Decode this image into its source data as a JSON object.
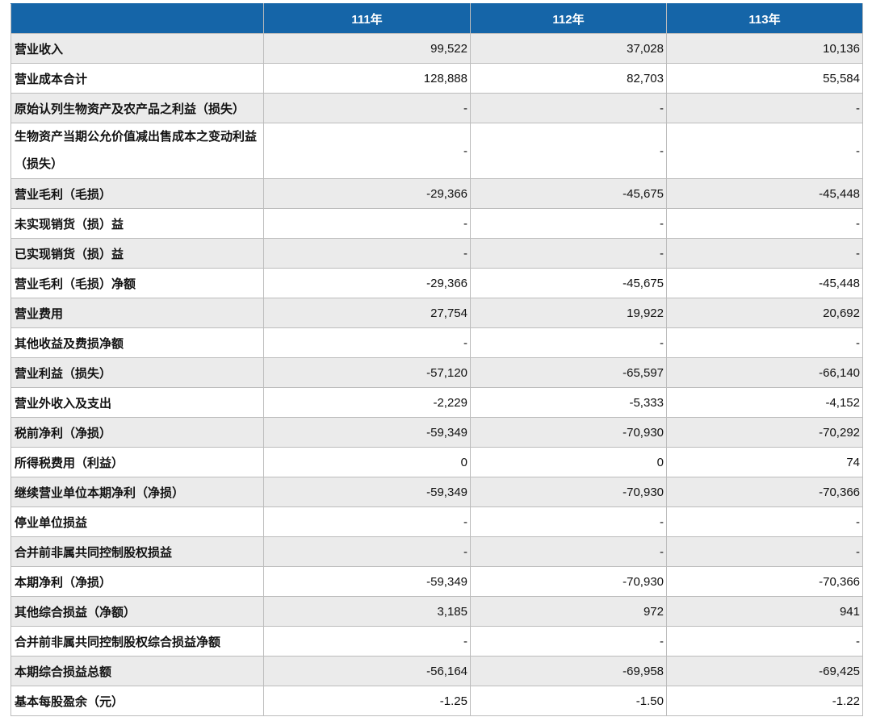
{
  "table": {
    "headers": [
      "",
      "111年",
      "112年",
      "113年"
    ],
    "rows": [
      {
        "label": "营业收入",
        "values": [
          "99,522",
          "37,028",
          "10,136"
        ]
      },
      {
        "label": "营业成本合计",
        "values": [
          "128,888",
          "82,703",
          "55,584"
        ]
      },
      {
        "label": "原始认列生物资产及农产品之利益（损失）",
        "values": [
          "-",
          "-",
          "-"
        ]
      },
      {
        "label": "生物资产当期公允价值减出售成本之变动利益（损失）",
        "values": [
          "-",
          "-",
          "-"
        ]
      },
      {
        "label": "营业毛利（毛损）",
        "values": [
          "-29,366",
          "-45,675",
          "-45,448"
        ]
      },
      {
        "label": "未实现销货（损）益",
        "values": [
          "-",
          "-",
          "-"
        ]
      },
      {
        "label": "已实现销货（损）益",
        "values": [
          "-",
          "-",
          "-"
        ]
      },
      {
        "label": "营业毛利（毛损）净额",
        "values": [
          "-29,366",
          "-45,675",
          "-45,448"
        ]
      },
      {
        "label": "营业费用",
        "values": [
          "27,754",
          "19,922",
          "20,692"
        ]
      },
      {
        "label": "其他收益及费损净额",
        "values": [
          "-",
          "-",
          "-"
        ]
      },
      {
        "label": "营业利益（损失）",
        "values": [
          "-57,120",
          "-65,597",
          "-66,140"
        ]
      },
      {
        "label": "营业外收入及支出",
        "values": [
          "-2,229",
          "-5,333",
          "-4,152"
        ]
      },
      {
        "label": "税前净利（净损）",
        "values": [
          "-59,349",
          "-70,930",
          "-70,292"
        ]
      },
      {
        "label": "所得税费用（利益）",
        "values": [
          "0",
          "0",
          "74"
        ]
      },
      {
        "label": "继续营业单位本期净利（净损）",
        "values": [
          "-59,349",
          "-70,930",
          "-70,366"
        ]
      },
      {
        "label": "停业单位损益",
        "values": [
          "-",
          "-",
          "-"
        ]
      },
      {
        "label": "合并前非属共同控制股权损益",
        "values": [
          "-",
          "-",
          "-"
        ]
      },
      {
        "label": "本期净利（净损）",
        "values": [
          "-59,349",
          "-70,930",
          "-70,366"
        ]
      },
      {
        "label": "其他综合损益（净额）",
        "values": [
          "3,185",
          "972",
          "941"
        ]
      },
      {
        "label": "合并前非属共同控制股权综合损益净额",
        "values": [
          "-",
          "-",
          "-"
        ]
      },
      {
        "label": "本期综合损益总额",
        "values": [
          "-56,164",
          "-69,958",
          "-69,425"
        ]
      },
      {
        "label": "基本每股盈余（元）",
        "values": [
          "-1.25",
          "-1.50",
          "-1.22"
        ]
      }
    ]
  }
}
